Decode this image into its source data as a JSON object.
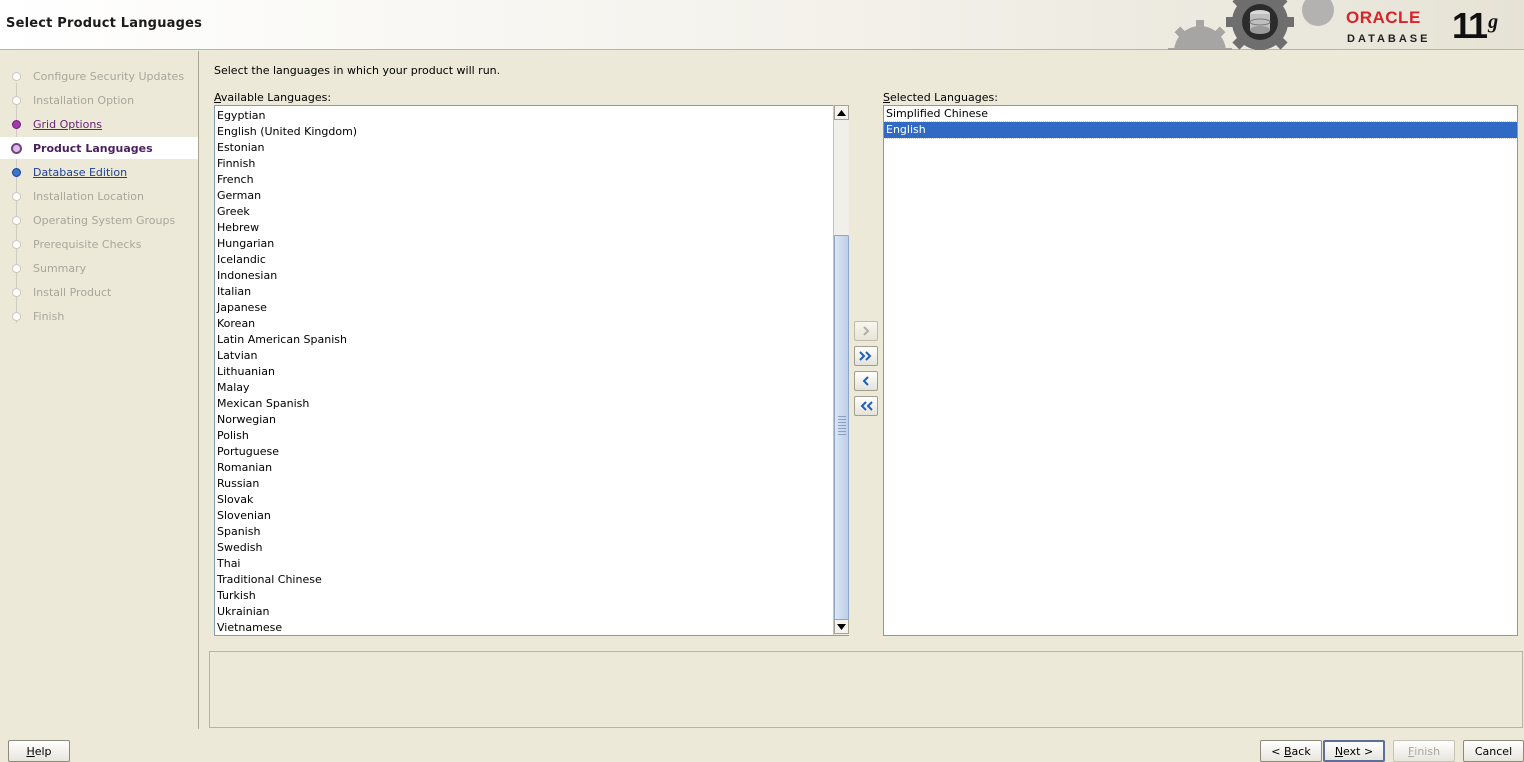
{
  "header": {
    "title": "Select Product Languages",
    "brand": "ORACLE",
    "product": "DATABASE",
    "version": "11",
    "version_suffix": "g"
  },
  "sidebar": {
    "steps": [
      {
        "label": "Configure Security Updates"
      },
      {
        "label": "Installation Option"
      },
      {
        "label": "Grid Options"
      },
      {
        "label": "Product Languages"
      },
      {
        "label": "Database Edition"
      },
      {
        "label": "Installation Location"
      },
      {
        "label": "Operating System Groups"
      },
      {
        "label": "Prerequisite Checks"
      },
      {
        "label": "Summary"
      },
      {
        "label": "Install Product"
      },
      {
        "label": "Finish"
      }
    ]
  },
  "main": {
    "instruction": "Select the languages in which your product will run.",
    "available_label_first": "A",
    "available_label_rest": "vailable Languages:",
    "selected_label_first": "S",
    "selected_label_rest": "elected Languages:",
    "available": [
      "Egyptian",
      "English (United Kingdom)",
      "Estonian",
      "Finnish",
      "French",
      "German",
      "Greek",
      "Hebrew",
      "Hungarian",
      "Icelandic",
      "Indonesian",
      "Italian",
      "Japanese",
      "Korean",
      "Latin American Spanish",
      "Latvian",
      "Lithuanian",
      "Malay",
      "Mexican Spanish",
      "Norwegian",
      "Polish",
      "Portuguese",
      "Romanian",
      "Russian",
      "Slovak",
      "Slovenian",
      "Spanish",
      "Swedish",
      "Thai",
      "Traditional Chinese",
      "Turkish",
      "Ukrainian",
      "Vietnamese"
    ],
    "selected": [
      "Simplified Chinese",
      "English"
    ],
    "selected_highlight": "English"
  },
  "buttons": {
    "help_first": "H",
    "help_rest": "elp",
    "back_prefix": "< ",
    "back_first": "B",
    "back_rest": "ack",
    "next_first": "N",
    "next_rest": "ext >",
    "finish_first": "F",
    "finish_rest": "inish",
    "cancel": "Cancel"
  },
  "colors": {
    "accent": "#316ac5",
    "active_step": "#4b1f5e",
    "brand_red": "#d8232a"
  }
}
